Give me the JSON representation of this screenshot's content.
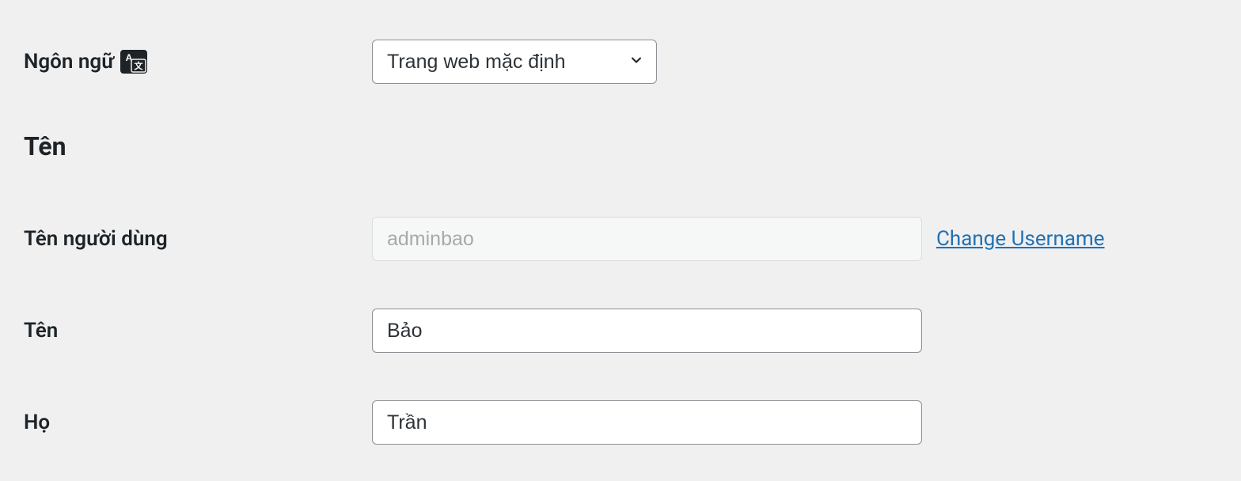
{
  "language": {
    "label": "Ngôn ngữ",
    "selected": "Trang web mặc định"
  },
  "section_name": {
    "heading": "Tên"
  },
  "username": {
    "label": "Tên người dùng",
    "value": "adminbao",
    "change_link": "Change Username"
  },
  "first_name": {
    "label": "Tên",
    "value": "Bảo"
  },
  "last_name": {
    "label": "Họ",
    "value": "Trần"
  }
}
